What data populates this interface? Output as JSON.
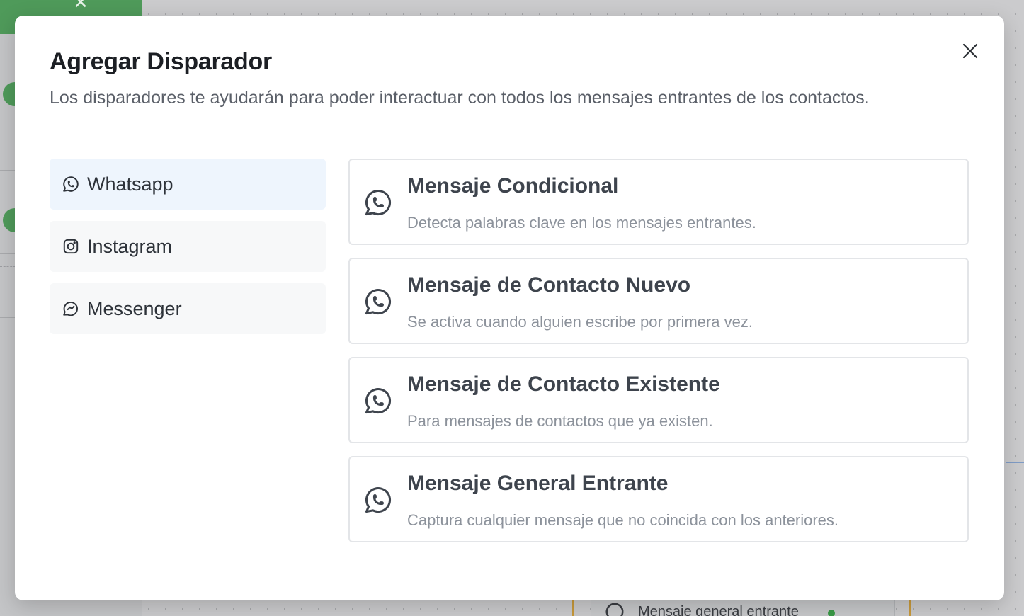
{
  "background": {
    "node_label": "Mensaje general entrante",
    "node_status_color": "#3a9a47"
  },
  "modal": {
    "title": "Agregar Disparador",
    "subtitle": "Los disparadores te ayudarán para poder interactuar con todos los mensajes entrantes de los contactos.",
    "close_icon": "close-icon"
  },
  "channels": [
    {
      "label": "Whatsapp",
      "icon": "whatsapp-icon",
      "active": true
    },
    {
      "label": "Instagram",
      "icon": "instagram-icon",
      "active": false
    },
    {
      "label": "Messenger",
      "icon": "messenger-icon",
      "active": false
    }
  ],
  "triggers": [
    {
      "title": "Mensaje Condicional",
      "description": "Detecta palabras clave en los mensajes entrantes.",
      "icon": "whatsapp-icon"
    },
    {
      "title": "Mensaje de Contacto Nuevo",
      "description": "Se activa cuando alguien escribe por primera vez.",
      "icon": "whatsapp-icon"
    },
    {
      "title": "Mensaje de Contacto Existente",
      "description": "Para mensajes de contactos que ya existen.",
      "icon": "whatsapp-icon"
    },
    {
      "title": "Mensaje General Entrante",
      "description": "Captura cualquier mensaje que no coincida con los anteriores.",
      "icon": "whatsapp-icon"
    }
  ],
  "colors": {
    "active_tab_bg": "#eef5fd",
    "tab_bg": "#f7f8f9",
    "card_border": "#e3e5e8",
    "title_text": "#1c1f24",
    "card_title_text": "#3e444d",
    "card_desc_text": "#8c929b",
    "background_green": "#4f9a5a"
  }
}
